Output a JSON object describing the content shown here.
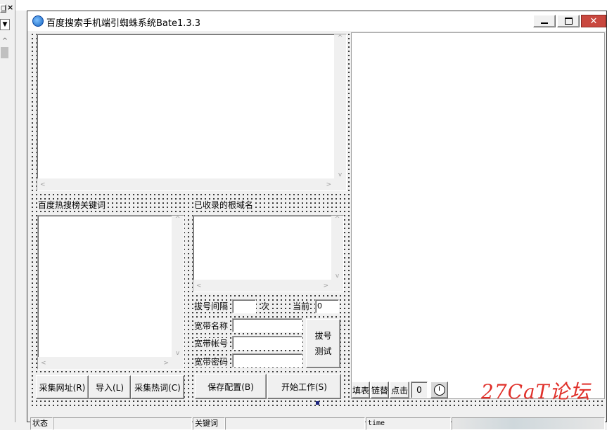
{
  "window": {
    "title": "百度搜索手机端引蜘蛛系统Bate1.3.3",
    "min_icon": "minimize-icon",
    "max_icon": "maximize-icon",
    "close_icon": "close-icon"
  },
  "left_edge": {
    "restore_glyph": "◻",
    "close_glyph": "×",
    "dropdown_glyph": "▼",
    "scroll_up_glyph": "^"
  },
  "sections": {
    "hot_keywords_label": "百度热搜榜关键词",
    "indexed_domains_label": "已收录的根域名"
  },
  "dial": {
    "interval_label": "拔号间隔",
    "interval_value": "",
    "times_label": "次",
    "current_label": "当前",
    "current_value": "0",
    "broadband_name_label": "宽带名称",
    "broadband_name_value": "",
    "broadband_account_label": "宽带帐号",
    "broadband_account_value": "",
    "broadband_password_label": "宽带密码",
    "broadband_password_value": "",
    "test_button_line1": "拔号",
    "test_button_line2": "测试"
  },
  "buttons": {
    "collect_urls": "采集网址(R)",
    "import": "导入(L)",
    "collect_hotwords": "采集热词(C)",
    "save_config": "保存配置(B)",
    "start_work": "开始工作(S)",
    "fill_form": "填表",
    "link_replace": "链替",
    "click": "点击",
    "counter_value": "0",
    "timer_icon": "stopwatch-icon"
  },
  "statusbar": {
    "status_label": "状态",
    "status_value": "",
    "keyword_label": "关键词",
    "keyword_value": "",
    "time_label": "time"
  },
  "watermark": {
    "text": "27CaT论坛"
  },
  "colors": {
    "title_bar_bg": "#ffffff",
    "watermark_red": "#e0302a"
  }
}
